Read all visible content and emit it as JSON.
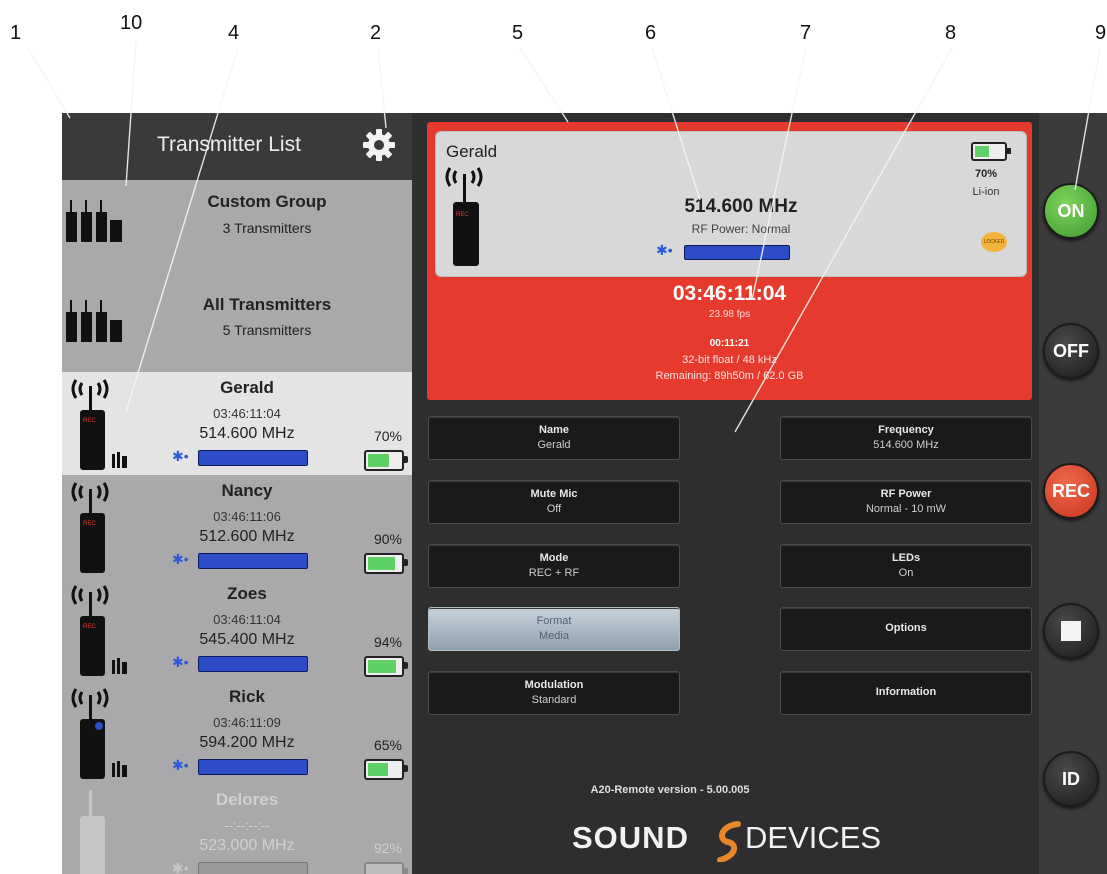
{
  "callouts": [
    "1",
    "10",
    "4",
    "2",
    "5",
    "6",
    "7",
    "8",
    "9"
  ],
  "left_panel": {
    "title": "Transmitter List",
    "groups": [
      {
        "title": "Custom Group",
        "subtitle": "3 Transmitters"
      },
      {
        "title": "All Transmitters",
        "subtitle": "5 Transmitters"
      }
    ],
    "transmitters": [
      {
        "name": "Gerald",
        "timecode": "03:46:11:04",
        "frequency": "514.600 MHz",
        "battery": "70%",
        "battery_level": 0.7,
        "selected": true
      },
      {
        "name": "Nancy",
        "timecode": "03:46:11:06",
        "frequency": "512.600 MHz",
        "battery": "90%",
        "battery_level": 0.9
      },
      {
        "name": "Zoes",
        "timecode": "03:46:11:04",
        "frequency": "545.400 MHz",
        "battery": "94%",
        "battery_level": 0.94
      },
      {
        "name": "Rick",
        "timecode": "03:46:11:09",
        "frequency": "594.200 MHz",
        "battery": "65%",
        "battery_level": 0.65
      },
      {
        "name": "Delores",
        "timecode": "--:--:--:--",
        "frequency": "523.000 MHz",
        "battery": "92%",
        "battery_level": 0.92,
        "inactive": true
      }
    ]
  },
  "detail": {
    "name": "Gerald",
    "frequency": "514.600 MHz",
    "rf_power": "RF Power: Normal",
    "battery": "70%",
    "battery_type": "Li-ion",
    "badge": "LOCKED",
    "timecode": "03:46:11:04",
    "fps": "23.98 fps",
    "elapsed": "00:11:21",
    "format": "32-bit float / 48 kHz",
    "remaining": "Remaining: 89h50m / 62.0 GB"
  },
  "settings": {
    "name_label": "Name",
    "name_value": "Gerald",
    "mute_label": "Mute Mic",
    "mute_value": "Off",
    "mode_label": "Mode",
    "mode_value": "REC + RF",
    "format_label": "Format",
    "format_value": "Media",
    "modulation_label": "Modulation",
    "modulation_value": "Standard",
    "frequency_label": "Frequency",
    "frequency_value": "514.600 MHz",
    "rfpower_label": "RF Power",
    "rfpower_value": "Normal - 10 mW",
    "leds_label": "LEDs",
    "leds_value": "On",
    "options_label": "Options",
    "information_label": "Information"
  },
  "footer": {
    "version": "A20-Remote version - 5.00.005",
    "logo_left": "SOUND",
    "logo_right": "DEVICES"
  },
  "side_buttons": {
    "on": "ON",
    "off": "OFF",
    "rec": "REC",
    "id": "ID"
  },
  "colors": {
    "record_red": "#e53a2d",
    "on_green": "#4caf3a",
    "rf_bar_blue": "#2c4cc8",
    "battery_green": "#5fd068"
  }
}
